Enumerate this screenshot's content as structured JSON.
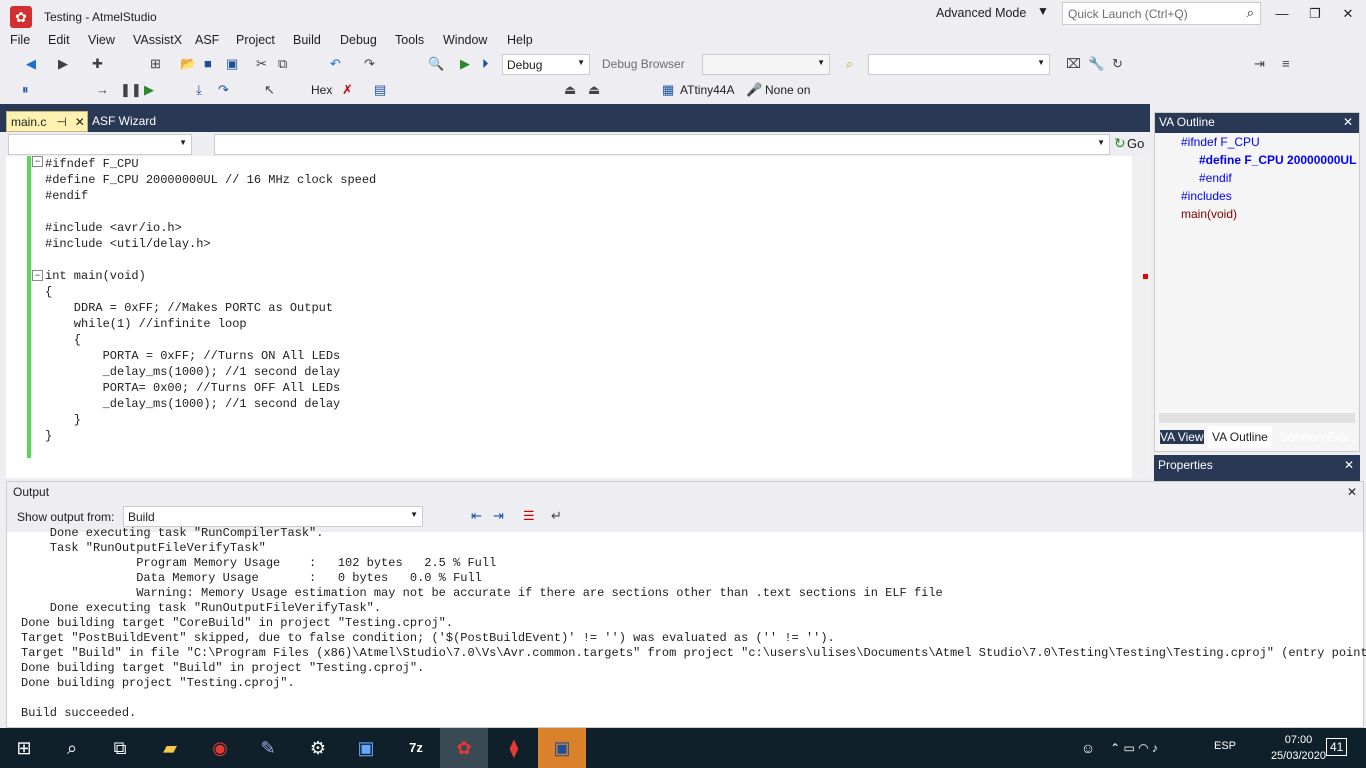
{
  "window": {
    "title": "Testing - AtmelStudio",
    "mode": "Advanced Mode",
    "quick_launch": "Quick Launch (Ctrl+Q)"
  },
  "menu": [
    "File",
    "Edit",
    "View",
    "VAssistX",
    "ASF",
    "Project",
    "Build",
    "Debug",
    "Tools",
    "Window",
    "Help"
  ],
  "toolbar": {
    "config": "Debug",
    "debug_browser": "Debug Browser",
    "hex": "Hex",
    "device": "ATtiny44A",
    "tool": "None on"
  },
  "tabs": {
    "main": "main.c",
    "asf": "ASF Wizard"
  },
  "editor": {
    "go": "Go",
    "lines": [
      "#ifndef F_CPU",
      "#define F_CPU 20000000UL // 16 MHz clock speed",
      "#endif",
      "",
      "#include <avr/io.h>",
      "#include <util/delay.h>",
      "",
      "int main(void)",
      "{",
      "    DDRA = 0xFF; //Makes PORTC as Output",
      "    while(1) //infinite loop",
      "    {",
      "        PORTA = 0xFF; //Turns ON All LEDs",
      "        _delay_ms(1000); //1 second delay",
      "        PORTA= 0x00; //Turns OFF All LEDs",
      "        _delay_ms(1000); //1 second delay",
      "    }",
      "}"
    ]
  },
  "va_outline": {
    "title": "VA Outline",
    "items": [
      "#ifndef F_CPU",
      "#define F_CPU 20000000UL",
      "#endif",
      "#includes",
      "main(void)"
    ],
    "tabs": [
      "VA View",
      "VA Outline",
      "Solution Exp..."
    ]
  },
  "properties": {
    "title": "Properties"
  },
  "output": {
    "title": "Output",
    "show_from_label": "Show output from:",
    "show_from": "Build",
    "text": "    Done executing task \"RunCompilerTask\".\n    Task \"RunOutputFileVerifyTask\"\n                Program Memory Usage    :   102 bytes   2.5 % Full\n                Data Memory Usage       :   0 bytes   0.0 % Full\n                Warning: Memory Usage estimation may not be accurate if there are sections other than .text sections in ELF file\n    Done executing task \"RunOutputFileVerifyTask\".\nDone building target \"CoreBuild\" in project \"Testing.cproj\".\nTarget \"PostBuildEvent\" skipped, due to false condition; ('$(PostBuildEvent)' != '') was evaluated as ('' != '').\nTarget \"Build\" in file \"C:\\Program Files (x86)\\Atmel\\Studio\\7.0\\Vs\\Avr.common.targets\" from project \"c:\\users\\ulises\\Documents\\Atmel Studio\\7.0\\Testing\\Testing\\Testing.cproj\" (entry point):\nDone building target \"Build\" in project \"Testing.cproj\".\nDone building project \"Testing.cproj\".\n\nBuild succeeded."
  },
  "taskbar": {
    "lang": "ESP",
    "time": "07:00",
    "date": "25/03/2020",
    "notif": "41"
  }
}
